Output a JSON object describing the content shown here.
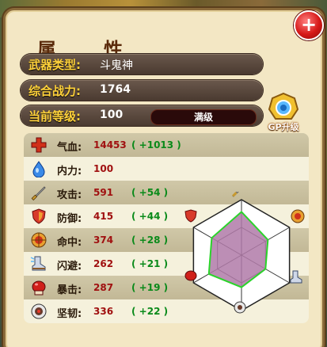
{
  "panel": {
    "title": "属　性",
    "close_icon_label": "+"
  },
  "info": {
    "weapon_type_label": "武器类型:",
    "weapon_type_value": "斗鬼神",
    "combat_power_label": "综合战力:",
    "combat_power_value": "1764",
    "level_label": "当前等级:",
    "level_value": "100",
    "max_level_text": "满级"
  },
  "gp_upgrade": {
    "label": "GP升级"
  },
  "stats": [
    {
      "icon": "cross-hp-icon",
      "name": "气血:",
      "value": "14453",
      "bonus": "( +1013 )"
    },
    {
      "icon": "water-drop-icon",
      "name": "内力:",
      "value": "100",
      "bonus": ""
    },
    {
      "icon": "sword-icon",
      "name": "攻击:",
      "value": "591",
      "bonus": "( +54 )"
    },
    {
      "icon": "shield-icon",
      "name": "防御:",
      "value": "415",
      "bonus": "( +44 )"
    },
    {
      "icon": "target-icon",
      "name": "命中:",
      "value": "374",
      "bonus": "( +28 )"
    },
    {
      "icon": "boot-icon",
      "name": "闪避:",
      "value": "262",
      "bonus": "( +21 )"
    },
    {
      "icon": "boxing-glove-icon",
      "name": "暴击:",
      "value": "287",
      "bonus": "( +19 )"
    },
    {
      "icon": "armor-icon",
      "name": "坚韧:",
      "value": "336",
      "bonus": "( +22 )"
    }
  ],
  "radar": {
    "axes": [
      "attack",
      "hit",
      "dodge",
      "toughness",
      "crit",
      "defense"
    ],
    "values": [
      0.78,
      0.55,
      0.5,
      0.58,
      0.68,
      0.62
    ],
    "fill_color": "#b07aa8",
    "outline_color": "#2ad42a"
  },
  "colors": {
    "label_gold": "#ffd23a",
    "value_red": "#a01010",
    "bonus_green": "#0a8a1a"
  }
}
